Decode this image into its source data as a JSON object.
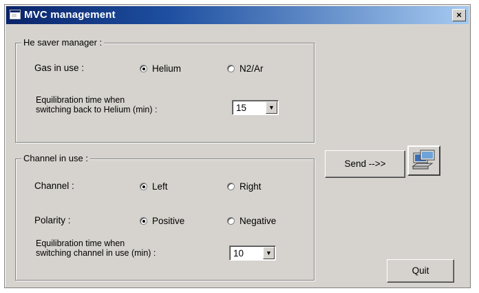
{
  "window": {
    "title": "MVC management",
    "close_label": "×"
  },
  "he_saver": {
    "legend": "He saver manager :",
    "gas_label": "Gas in use :",
    "option_helium": "Helium",
    "option_n2ar": "N2/Ar",
    "selected": "Helium",
    "equil_label_line1": "Equilibration time when",
    "equil_label_line2": "switching back to Helium (min) :",
    "equil_value": "15"
  },
  "channel": {
    "legend": "Channel in use :",
    "channel_label": "Channel :",
    "option_left": "Left",
    "option_right": "Right",
    "channel_selected": "Left",
    "polarity_label": "Polarity :",
    "option_positive": "Positive",
    "option_negative": "Negative",
    "polarity_selected": "Positive",
    "equil_label_line1": "Equilibration time when",
    "equil_label_line2": "switching channel in use (min) :",
    "equil_value": "10"
  },
  "buttons": {
    "send_label": "Send -->>",
    "quit_label": "Quit"
  },
  "icons": {
    "app": "app-window-icon",
    "network": "network-computers-icon",
    "dropdown": "chevron-down-icon"
  },
  "colors": {
    "titlebar_start": "#0a246a",
    "titlebar_end": "#a6caf0",
    "face": "#d6d3ce"
  }
}
